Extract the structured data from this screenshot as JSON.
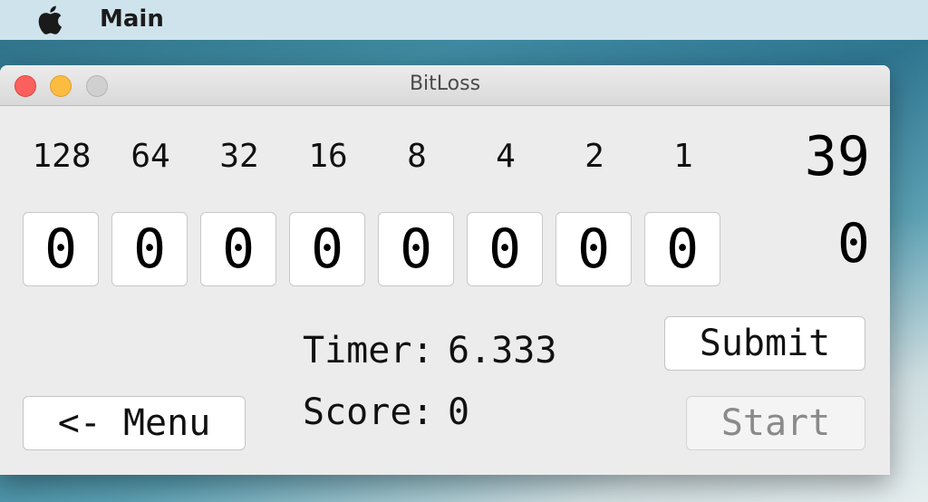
{
  "menubar": {
    "app_name": "Main",
    "apple_icon": "apple-logo-icon"
  },
  "window": {
    "title": "BitLoss"
  },
  "bits": {
    "place_values": [
      "128",
      "64",
      "32",
      "16",
      "8",
      "4",
      "2",
      "1"
    ],
    "values": [
      "0",
      "0",
      "0",
      "0",
      "0",
      "0",
      "0",
      "0"
    ]
  },
  "target_number": "39",
  "current_value": "0",
  "stats": {
    "timer_label": "Timer:",
    "timer_value": "6.333",
    "score_label": "Score:",
    "score_value": "0"
  },
  "buttons": {
    "submit": "Submit",
    "start": "Start",
    "menu": "<- Menu"
  }
}
